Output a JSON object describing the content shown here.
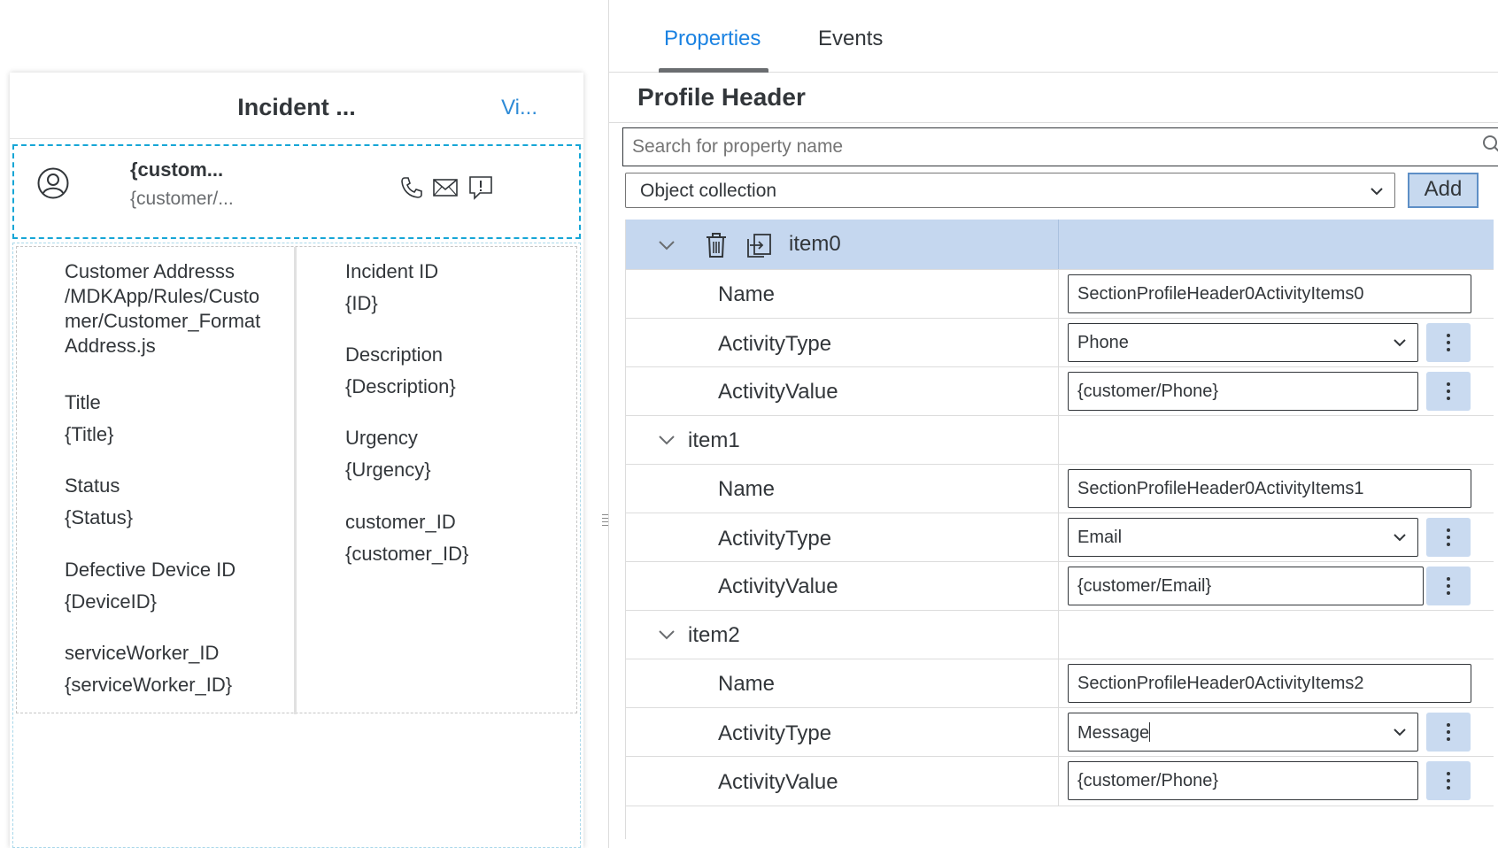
{
  "preview": {
    "title": "Incident ...",
    "action": "Vi...",
    "profile": {
      "name": "{custom...",
      "subtitle": "{customer/...",
      "activity_icons": [
        "phone-icon",
        "email-icon",
        "message-icon"
      ]
    },
    "key_values_left": [
      {
        "key": "Customer Addresss\n/MDKApp/Rules/Custo\nmer/Customer_Format\nAddress.js",
        "value": ""
      },
      {
        "key": "Title",
        "value": "{Title}"
      },
      {
        "key": "Status",
        "value": "{Status}"
      },
      {
        "key": "Defective Device ID",
        "value": "{DeviceID}"
      },
      {
        "key": "serviceWorker_ID",
        "value": "{serviceWorker_ID}"
      }
    ],
    "key_values_right": [
      {
        "key": "Incident ID",
        "value": "{ID}"
      },
      {
        "key": "Description",
        "value": "{Description}"
      },
      {
        "key": "Urgency",
        "value": "{Urgency}"
      },
      {
        "key": "customer_ID",
        "value": "{customer_ID}"
      }
    ]
  },
  "panel": {
    "tabs": [
      {
        "label": "Properties",
        "active": true
      },
      {
        "label": "Events",
        "active": false
      }
    ],
    "section_title": "Profile Header",
    "search_placeholder": "Search for property name",
    "collection_select": "Object collection",
    "add_label": "Add",
    "items": [
      {
        "label": "item0",
        "selected": true,
        "name_label": "Name",
        "name_value": "SectionProfileHeader0ActivityItems0",
        "type_label": "ActivityType",
        "type_value": "Phone",
        "value_label": "ActivityValue",
        "value_value": "{customer/Phone}"
      },
      {
        "label": "item1",
        "selected": false,
        "name_label": "Name",
        "name_value": "SectionProfileHeader0ActivityItems1",
        "type_label": "ActivityType",
        "type_value": "Email",
        "value_label": "ActivityValue",
        "value_value": "{customer/Email}"
      },
      {
        "label": "item2",
        "selected": false,
        "name_label": "Name",
        "name_value": "SectionProfileHeader0ActivityItems2",
        "type_label": "ActivityType",
        "type_value": "Message",
        "value_label": "ActivityValue",
        "value_value": "{customer/Phone}"
      }
    ]
  },
  "colors": {
    "accent": "#1a82e2",
    "selection": "#c5d7ef",
    "button": "#c9daf0",
    "dashed_outline": "#16a6d6"
  }
}
